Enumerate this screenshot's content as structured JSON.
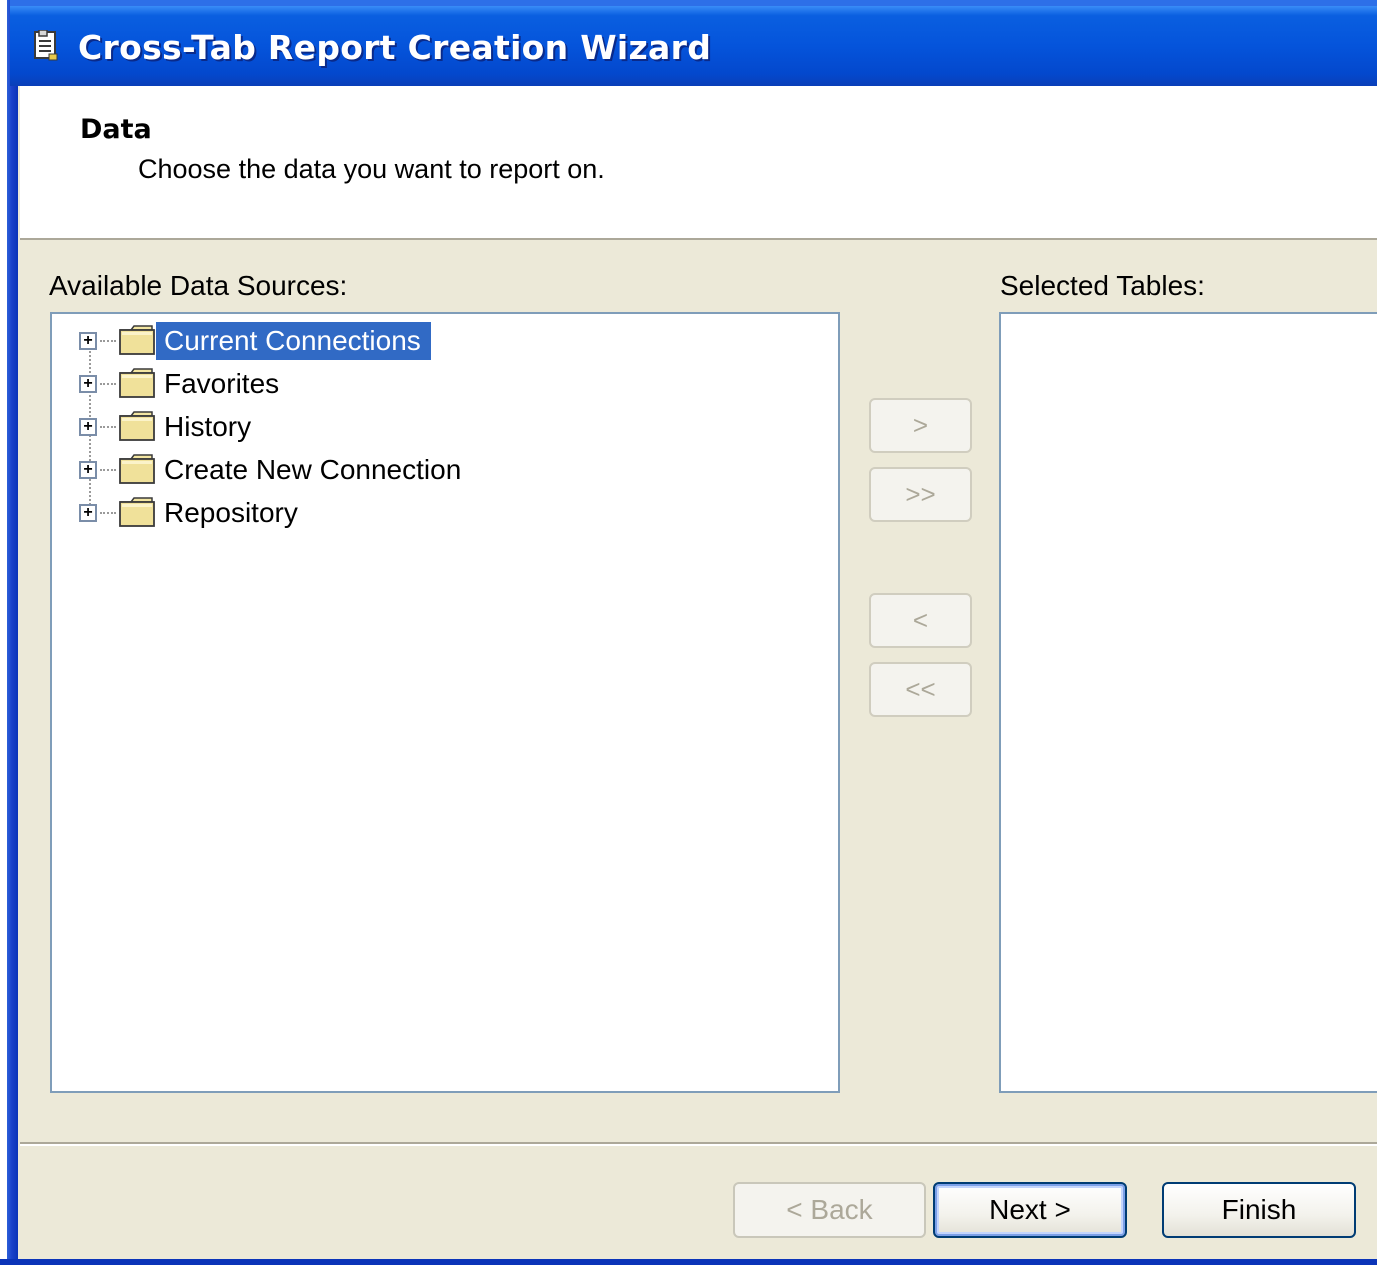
{
  "window": {
    "title": "Cross-Tab Report Creation Wizard",
    "icon": "wizard-document-icon"
  },
  "header": {
    "title": "Data",
    "subtitle": "Choose the data you want to report on."
  },
  "available_sources": {
    "label": "Available Data Sources:",
    "items": [
      {
        "label": "Current Connections",
        "icon": "folder-icon",
        "expander": "+",
        "selected": true
      },
      {
        "label": "Favorites",
        "icon": "folder-icon",
        "expander": "+",
        "selected": false
      },
      {
        "label": "History",
        "icon": "folder-icon",
        "expander": "+",
        "selected": false
      },
      {
        "label": "Create New Connection",
        "icon": "folder-icon",
        "expander": "+",
        "selected": false
      },
      {
        "label": "Repository",
        "icon": "folder-icon",
        "expander": "+",
        "selected": false
      }
    ]
  },
  "selected_tables": {
    "label": "Selected Tables:",
    "items": []
  },
  "move_buttons": {
    "add_one": ">",
    "add_all": ">>",
    "remove_one": "<",
    "remove_all": "<<"
  },
  "footer": {
    "back_label": "< Back",
    "next_label": "Next >",
    "finish_label": "Finish"
  },
  "colors": {
    "titlebar": "#0554db",
    "selection": "#316ac5",
    "dialog_bg": "#ece9d8"
  }
}
